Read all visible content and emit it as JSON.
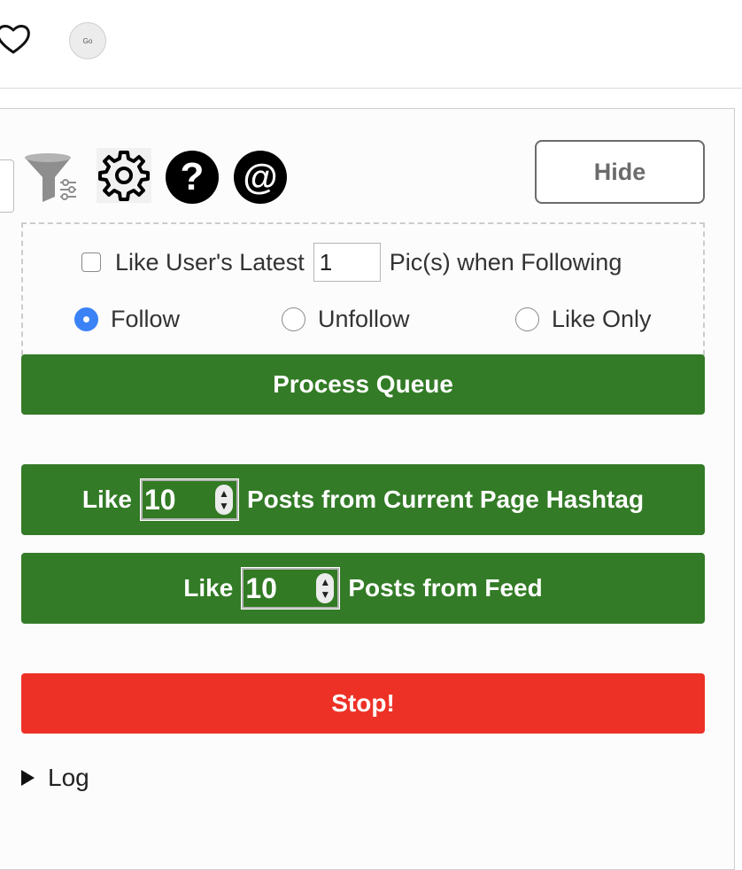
{
  "topbar": {
    "avatar_text": "Go"
  },
  "toolbar": {
    "hide_label": "Hide",
    "help_glyph": "?",
    "at_glyph": "@"
  },
  "options": {
    "like_latest_prefix": "Like User's Latest",
    "like_latest_value": "1",
    "like_latest_suffix": "Pic(s) when Following",
    "like_latest_checked": false,
    "mode_follow": "Follow",
    "mode_unfollow": "Unfollow",
    "mode_like_only": "Like Only",
    "selected_mode": "Follow"
  },
  "actions": {
    "process_queue": "Process Queue",
    "hashtag_prefix": "Like",
    "hashtag_count": "10",
    "hashtag_suffix": "Posts from Current Page Hashtag",
    "feed_prefix": "Like",
    "feed_count": "10",
    "feed_suffix": "Posts from Feed",
    "stop": "Stop!"
  },
  "log": {
    "label": "Log"
  },
  "colors": {
    "green": "#337b26",
    "red": "#ed3126",
    "radio_selected": "#3b82f6"
  },
  "icons": [
    "heart-icon",
    "filter-icon",
    "gear-icon",
    "help-icon",
    "at-icon",
    "disclosure-triangle-icon"
  ]
}
